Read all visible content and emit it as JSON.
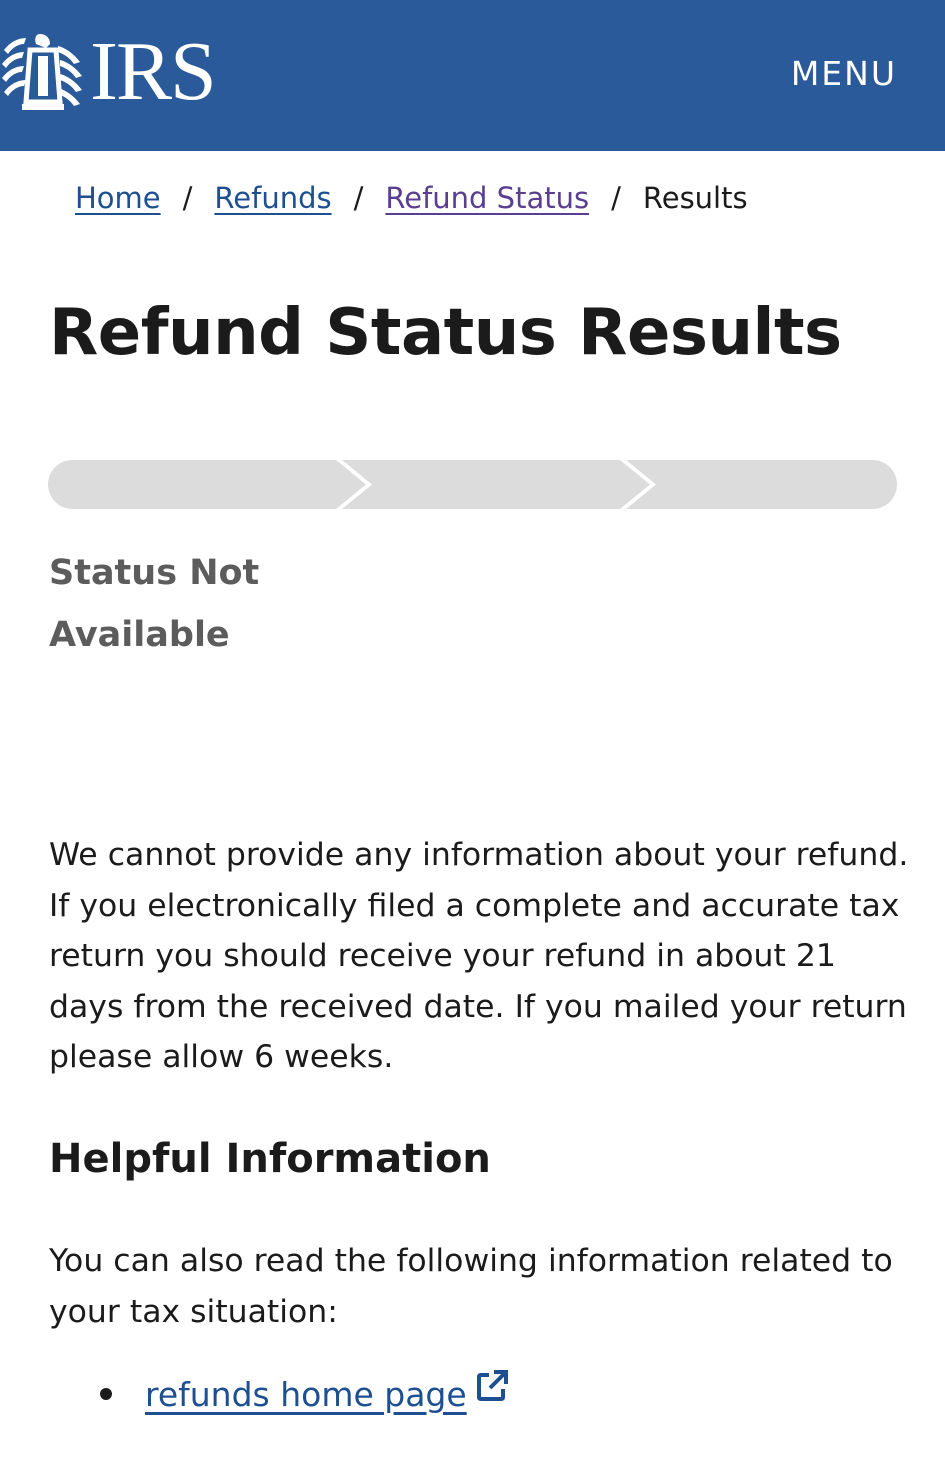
{
  "header": {
    "logo_text": "IRS",
    "menu_label": "MENU",
    "background_color": "#2a5a9a"
  },
  "breadcrumb": {
    "items": [
      {
        "label": "Home"
      },
      {
        "label": "Refunds"
      },
      {
        "label": "Refund Status"
      }
    ],
    "separator": "/",
    "current": "Results"
  },
  "main": {
    "title": "Refund Status Results",
    "progress": {
      "steps_total": 3,
      "steps_completed": 0
    },
    "status_label": "Status Not Available",
    "message": "We cannot provide any information about your refund. If you electronically filed a complete and accurate tax return you should receive your refund in about 21 days from the received date. If you mailed your return please allow 6 weeks.",
    "helpful": {
      "heading": "Helpful Information",
      "intro": "You can also read the following information related to your tax situation:",
      "links": [
        {
          "label": "refunds home page",
          "icon": "external-link-icon"
        }
      ]
    }
  },
  "colors": {
    "link": "#1e4f91",
    "visited_link": "#5a3e8f",
    "progress_inactive": "#dcdcdc",
    "status_text": "#5c5c5c"
  }
}
